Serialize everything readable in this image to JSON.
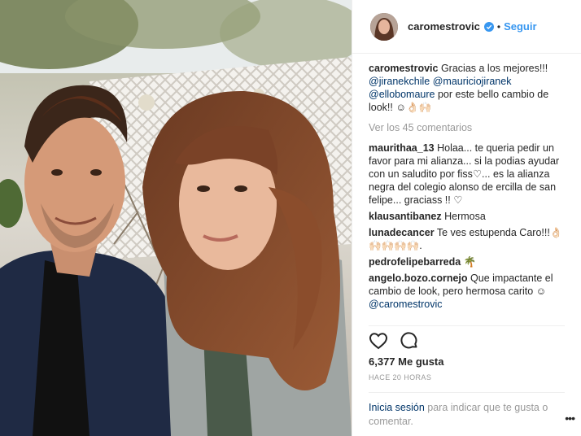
{
  "header": {
    "username": "caromestrovic",
    "separator": "•",
    "follow_label": "Seguir"
  },
  "caption": {
    "username": "caromestrovic",
    "text_1": "Gracias a los mejores!!!",
    "mention_1": "@jiranekchile",
    "mention_2": "@mauriciojiranek",
    "mention_3": "@ellobomaure",
    "text_2": "por este bello cambio de look!! ☺👌🏻🙌🏻"
  },
  "view_all": "Ver los 45 comentarios",
  "comments": [
    {
      "user": "maurithaa_13",
      "text": "Holaa... te queria pedir un favor para mi alianza... si la podias ayudar con un saludito por fiss♡... es la alianza negra del colegio alonso de ercilla de san felipe... graciass !! ♡"
    },
    {
      "user": "klausantibanez",
      "text": "Hermosa"
    },
    {
      "user": "lunadecancer",
      "text": "Te ves estupenda Caro!!!👌🏻🙌🏻🙌🏻🙌🏻🙌🏻."
    },
    {
      "user": "pedrofelipebarreda",
      "text": "🌴"
    },
    {
      "user": "angelo.bozo.cornejo",
      "text": "Que impactante el cambio de look, pero hermosa carito ☺",
      "mention": "@caromestrovic"
    }
  ],
  "icons": {
    "verified": "verified-badge-icon",
    "like": "heart-outline-icon",
    "comment": "speech-bubble-icon",
    "more": "ellipsis-icon"
  },
  "colors": {
    "link": "#3897f0",
    "mention": "#003569",
    "muted": "#999999"
  },
  "likes": "6,377 Me gusta",
  "time": "HACE 20 HORAS",
  "login": {
    "link": "Inicia sesión",
    "text": "para indicar que te gusta o comentar."
  },
  "more_label": "•••"
}
